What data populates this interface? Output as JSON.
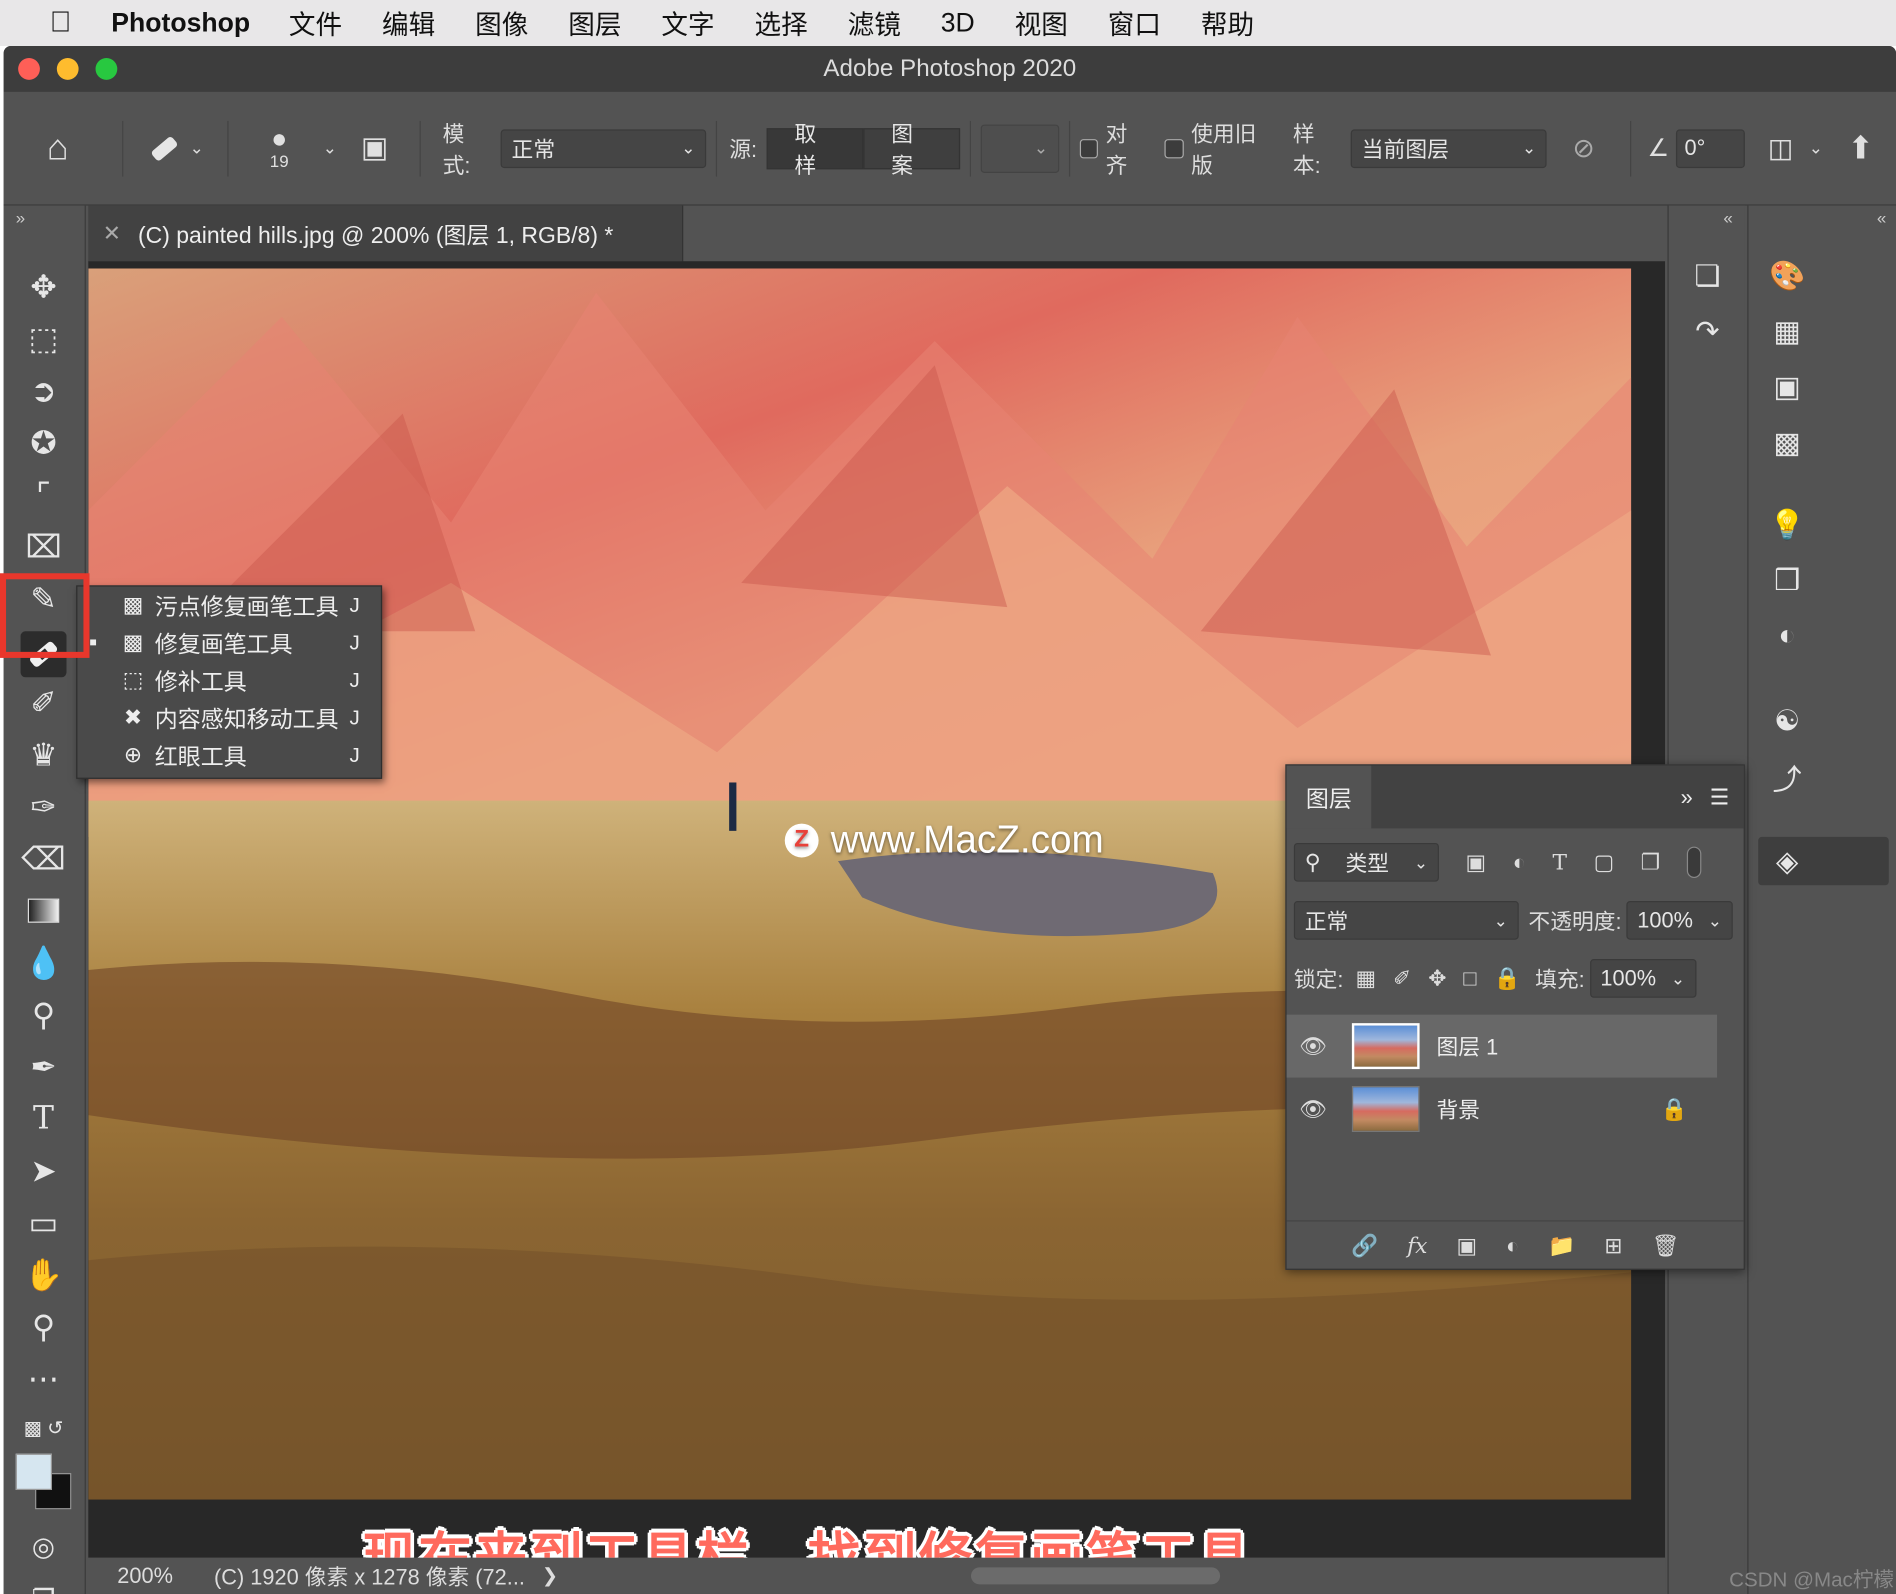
{
  "menubar": {
    "app_name": "Photoshop",
    "items": [
      "文件",
      "编辑",
      "图像",
      "图层",
      "文字",
      "选择",
      "滤镜",
      "3D",
      "视图",
      "窗口",
      "帮助"
    ]
  },
  "window": {
    "title": "Adobe Photoshop 2020"
  },
  "options_bar": {
    "brush_size": "19",
    "mode_label": "模式:",
    "mode_value": "正常",
    "source_label": "源:",
    "source_sampled": "取样",
    "source_pattern": "图案",
    "aligned_label": "对齐",
    "legacy_label": "使用旧版",
    "sample_label": "样本:",
    "sample_value": "当前图层",
    "angle_value": "0°"
  },
  "document": {
    "tab_title": "(C) painted hills.jpg @ 200% (图层 1, RGB/8) *",
    "zoom": "200%",
    "doc_info": "(C) 1920 像素 x 1278 像素 (72...",
    "watermark": "www.MacZ.com",
    "watermark_logo": "Z",
    "caption": "现在来到工具栏，找到修复画笔工具"
  },
  "healing_flyout": {
    "items": [
      {
        "label": "污点修复画笔工具",
        "key": "J",
        "icon": "spot-healing-brush-icon"
      },
      {
        "label": "修复画笔工具",
        "key": "J",
        "icon": "healing-brush-icon"
      },
      {
        "label": "修补工具",
        "key": "J",
        "icon": "patch-icon"
      },
      {
        "label": "内容感知移动工具",
        "key": "J",
        "icon": "content-aware-move-icon"
      },
      {
        "label": "红眼工具",
        "key": "J",
        "icon": "red-eye-icon"
      }
    ]
  },
  "layers_panel": {
    "title": "图层",
    "filter_value": "类型",
    "blend_mode": "正常",
    "opacity_label": "不透明度:",
    "opacity_value": "100%",
    "lock_label": "锁定:",
    "fill_label": "填充:",
    "fill_value": "100%",
    "layers": [
      {
        "name": "图层 1",
        "selected": true,
        "locked": false
      },
      {
        "name": "背景",
        "selected": false,
        "locked": true
      }
    ]
  },
  "credit": "CSDN @Mac柠檬",
  "colors": {
    "highlight": "#e8372c",
    "caption": "#ff6a5d",
    "panel": "#535353"
  }
}
